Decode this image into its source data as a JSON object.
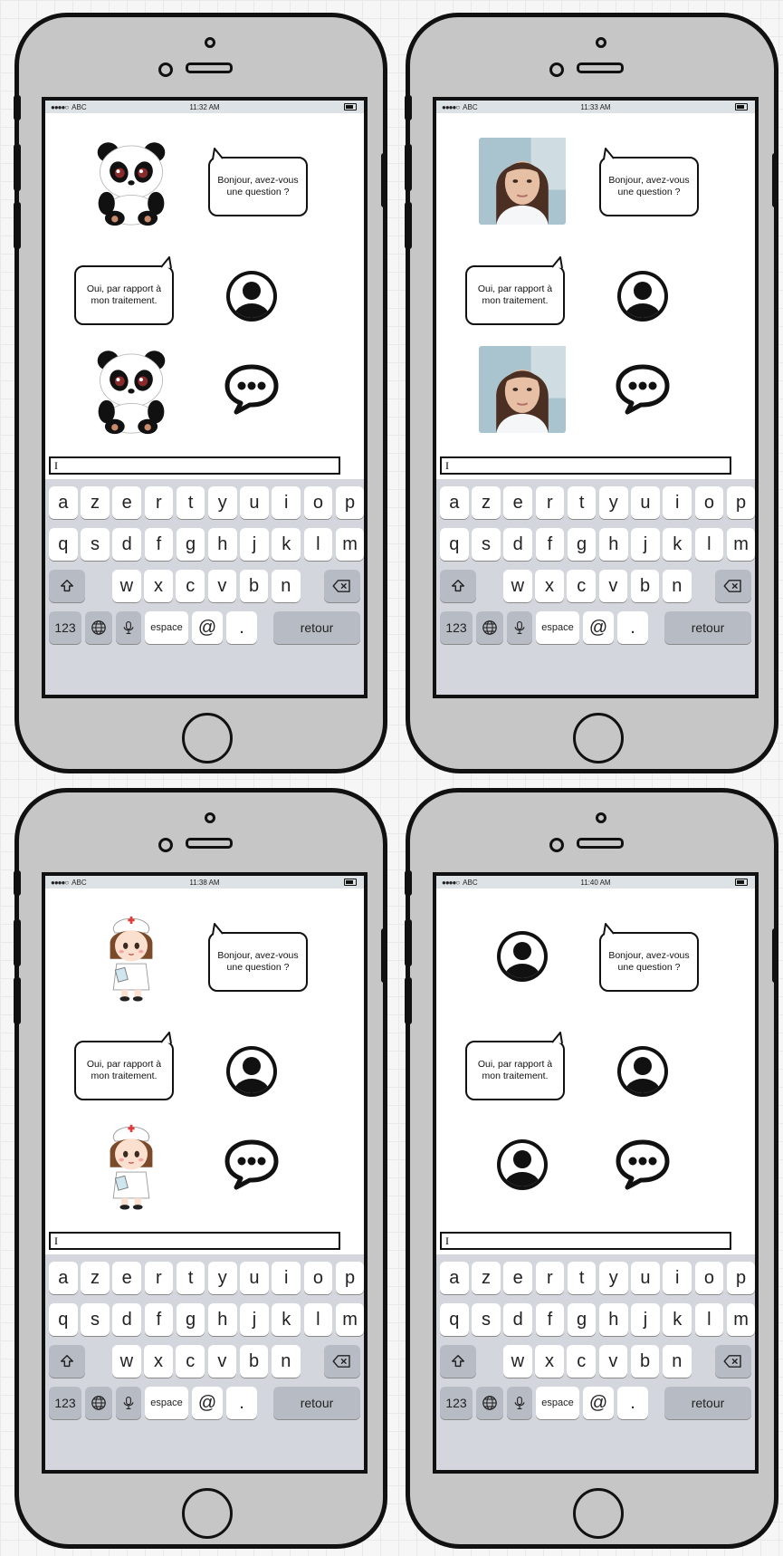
{
  "screens": [
    {
      "avatar": "panda-avatar",
      "status": {
        "carrier": "ABC",
        "time": "11:32 AM"
      },
      "bot_message": "Bonjour, avez-vous une question ?",
      "user_message": "Oui, par rapport à mon traitement.",
      "input_value": "I"
    },
    {
      "avatar": "woman-photo-avatar",
      "status": {
        "carrier": "ABC",
        "time": "11:33 AM"
      },
      "bot_message": "Bonjour, avez-vous une question ?",
      "user_message": "Oui, par rapport à mon traitement.",
      "input_value": "I"
    },
    {
      "avatar": "nurse-avatar",
      "status": {
        "carrier": "ABC",
        "time": "11:38 AM"
      },
      "bot_message": "Bonjour, avez-vous une question ?",
      "user_message": "Oui, par rapport à mon traitement.",
      "input_value": "I"
    },
    {
      "avatar": "generic-person-avatar",
      "status": {
        "carrier": "ABC",
        "time": "11:40 AM"
      },
      "bot_message": "Bonjour, avez-vous une question ?",
      "user_message": "Oui, par rapport à mon traitement.",
      "input_value": "I"
    }
  ],
  "keyboard": {
    "row1": [
      "a",
      "z",
      "e",
      "r",
      "t",
      "y",
      "u",
      "i",
      "o",
      "p"
    ],
    "row2": [
      "q",
      "s",
      "d",
      "f",
      "g",
      "h",
      "j",
      "k",
      "l",
      "m"
    ],
    "row3": [
      "w",
      "x",
      "c",
      "v",
      "b",
      "n"
    ],
    "numbers_label": "123",
    "space_label": "espace",
    "at_label": "@",
    "period_label": ".",
    "return_label": "retour",
    "shift_icon": "shift-icon",
    "backspace_icon": "backspace-icon",
    "globe_icon": "globe-icon",
    "mic_icon": "microphone-icon"
  },
  "colors": {
    "phone_body": "#c6c6c6",
    "outline": "#111111",
    "keyboard_bg": "#d3d6dc",
    "statusbar_bg": "#dde2e6"
  }
}
